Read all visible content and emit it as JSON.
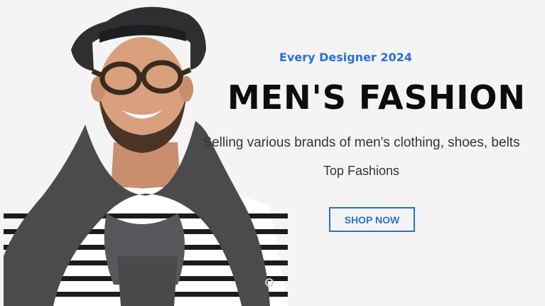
{
  "hero": {
    "eyebrow": "Every Designer 2024",
    "title": "MEN'S FASHION",
    "subtitle": "Selling various brands of men's clothing, shoes, belts",
    "tagline": "Top Fashions",
    "cta_label": "SHOP NOW",
    "accent_color": "#2a6fd8",
    "slider_dots": 1
  }
}
